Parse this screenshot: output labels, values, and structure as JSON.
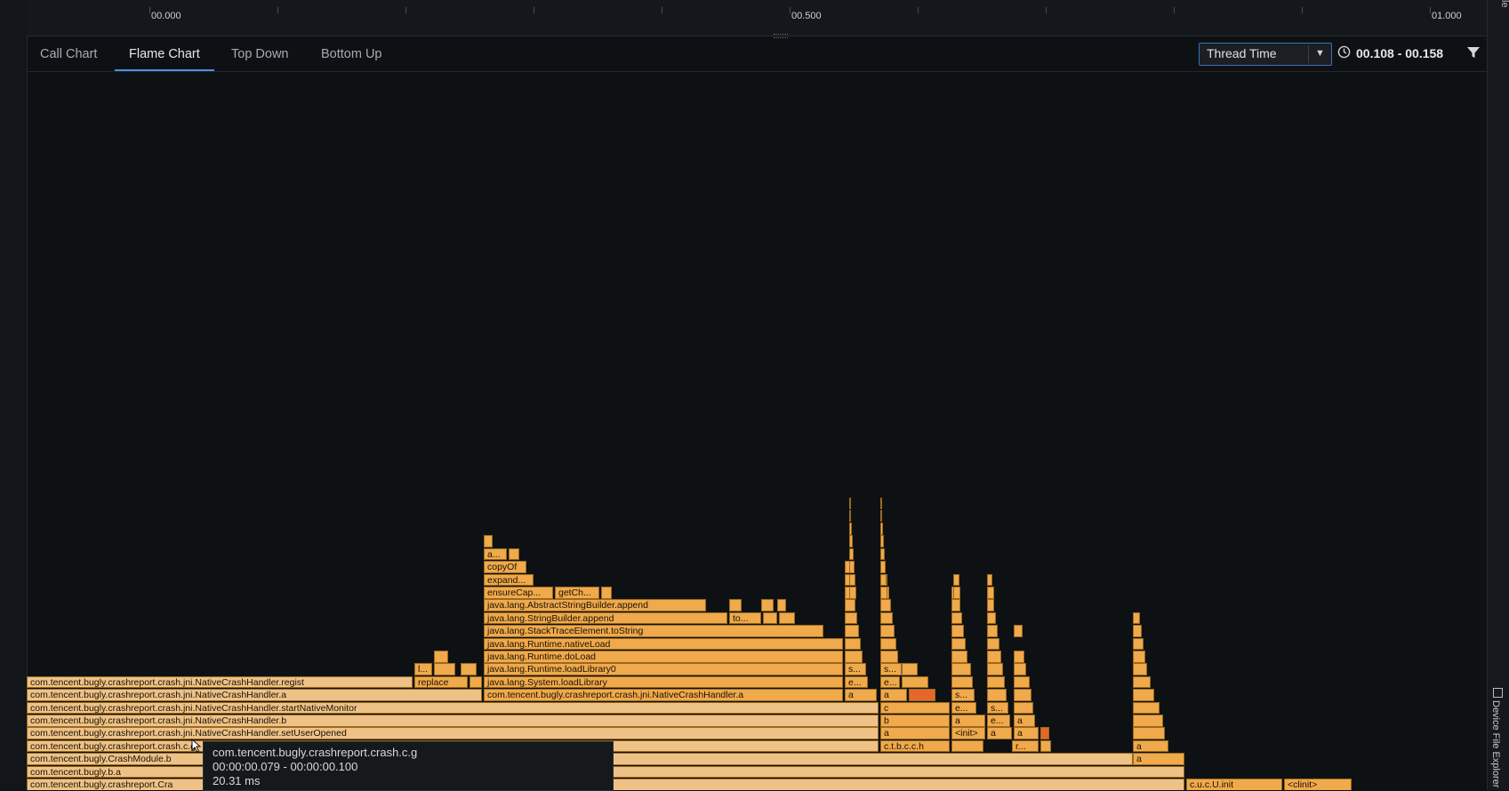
{
  "ruler": {
    "labels": [
      "00.000",
      "00.500",
      "01.000"
    ]
  },
  "tabs": [
    {
      "label": "Call Chart"
    },
    {
      "label": "Flame Chart"
    },
    {
      "label": "Top Down"
    },
    {
      "label": "Bottom Up"
    }
  ],
  "toolbar": {
    "clock_type": "Thread Time",
    "range": "00.108 - 00.158"
  },
  "side_panel": {
    "top_label": "le",
    "device_file_explorer": "Device File Explorer"
  },
  "colors": {
    "frame": "#f0a94b",
    "frame_pale": "#eec287",
    "frame_hot": "#e5672a",
    "accent": "#4a8fe0",
    "background": "#0e1114"
  },
  "flame_frames": [
    "com.tencent.bugly.crashreport.Cra",
    "com.tencent.bugly.b.a",
    "com.tencent.bugly.CrashModule.b",
    "com.tencent.bugly.crashreport.crash.c.g",
    "com.tencent.bugly.crashreport.crash.jni.NativeCrashHandler.setUserOpened",
    "com.tencent.bugly.crashreport.crash.jni.NativeCrashHandler.b",
    "com.tencent.bugly.crashreport.crash.jni.NativeCrashHandler.startNativeMonitor",
    "com.tencent.bugly.crashreport.crash.jni.NativeCrashHandler.a",
    "com.tencent.bugly.crashreport.crash.jni.NativeCrashHandler.regist",
    "c.u.c.U.init",
    "<clinit>",
    "c.t.b.c.c.h",
    "<init>",
    "a",
    "b",
    "c",
    "e...",
    "s...",
    "r...",
    "com.tencent.bugly.crashreport.crash.jni.NativeCrashHandler.a",
    "replace",
    "l...",
    "java.lang.System.loadLibrary",
    "java.lang.Runtime.loadLibrary0",
    "java.lang.Runtime.doLoad",
    "java.lang.Runtime.nativeLoad",
    "java.lang.StackTraceElement.toString",
    "java.lang.StringBuilder.append",
    "java.lang.AbstractStringBuilder.append",
    "ensureCap...",
    "getCh...",
    "expand...",
    "copyOf",
    "a...",
    "to..."
  ],
  "tooltip": {
    "method": "com.tencent.bugly.crashreport.crash.c.g",
    "time_range": "00:00:00.079 - 00:00:00.100",
    "duration": "20.31 ms"
  }
}
